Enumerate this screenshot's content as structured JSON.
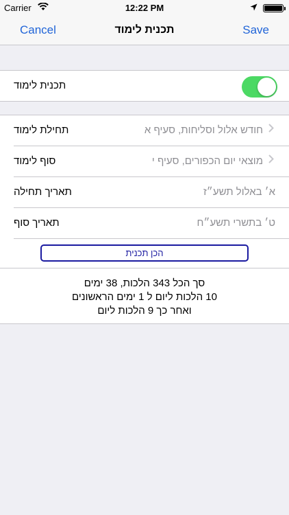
{
  "status_bar": {
    "carrier": "Carrier",
    "time": "12:22 PM"
  },
  "nav": {
    "cancel": "Cancel",
    "title": "תכנית לימוד",
    "save": "Save",
    "accent_color": "#2165d8"
  },
  "toggle_row": {
    "label": "תכנית לימוד",
    "on": true,
    "on_color": "#4cd964"
  },
  "rows": [
    {
      "label": "תחילת לימוד",
      "value": "חודש אלול וסליחות, סעיף א",
      "chevron": true
    },
    {
      "label": "סוף לימוד",
      "value": "מוצאי יום הכפורים, סעיף י",
      "chevron": true
    },
    {
      "label": "תאריך תחילה",
      "value": "א׳ באלול תשע״ז",
      "chevron": false
    },
    {
      "label": "תאריך סוף",
      "value": "ט׳ בתשרי תשע״ח",
      "chevron": false
    }
  ],
  "make_plan_button": "הכן תכנית",
  "summary": {
    "line1": "סך הכל 343 הלכות, 38 ימים",
    "line2": "10 הלכות ליום  ל 1 ימים הראשונים",
    "line3": "ואחר כך 9 הלכות ליום"
  }
}
